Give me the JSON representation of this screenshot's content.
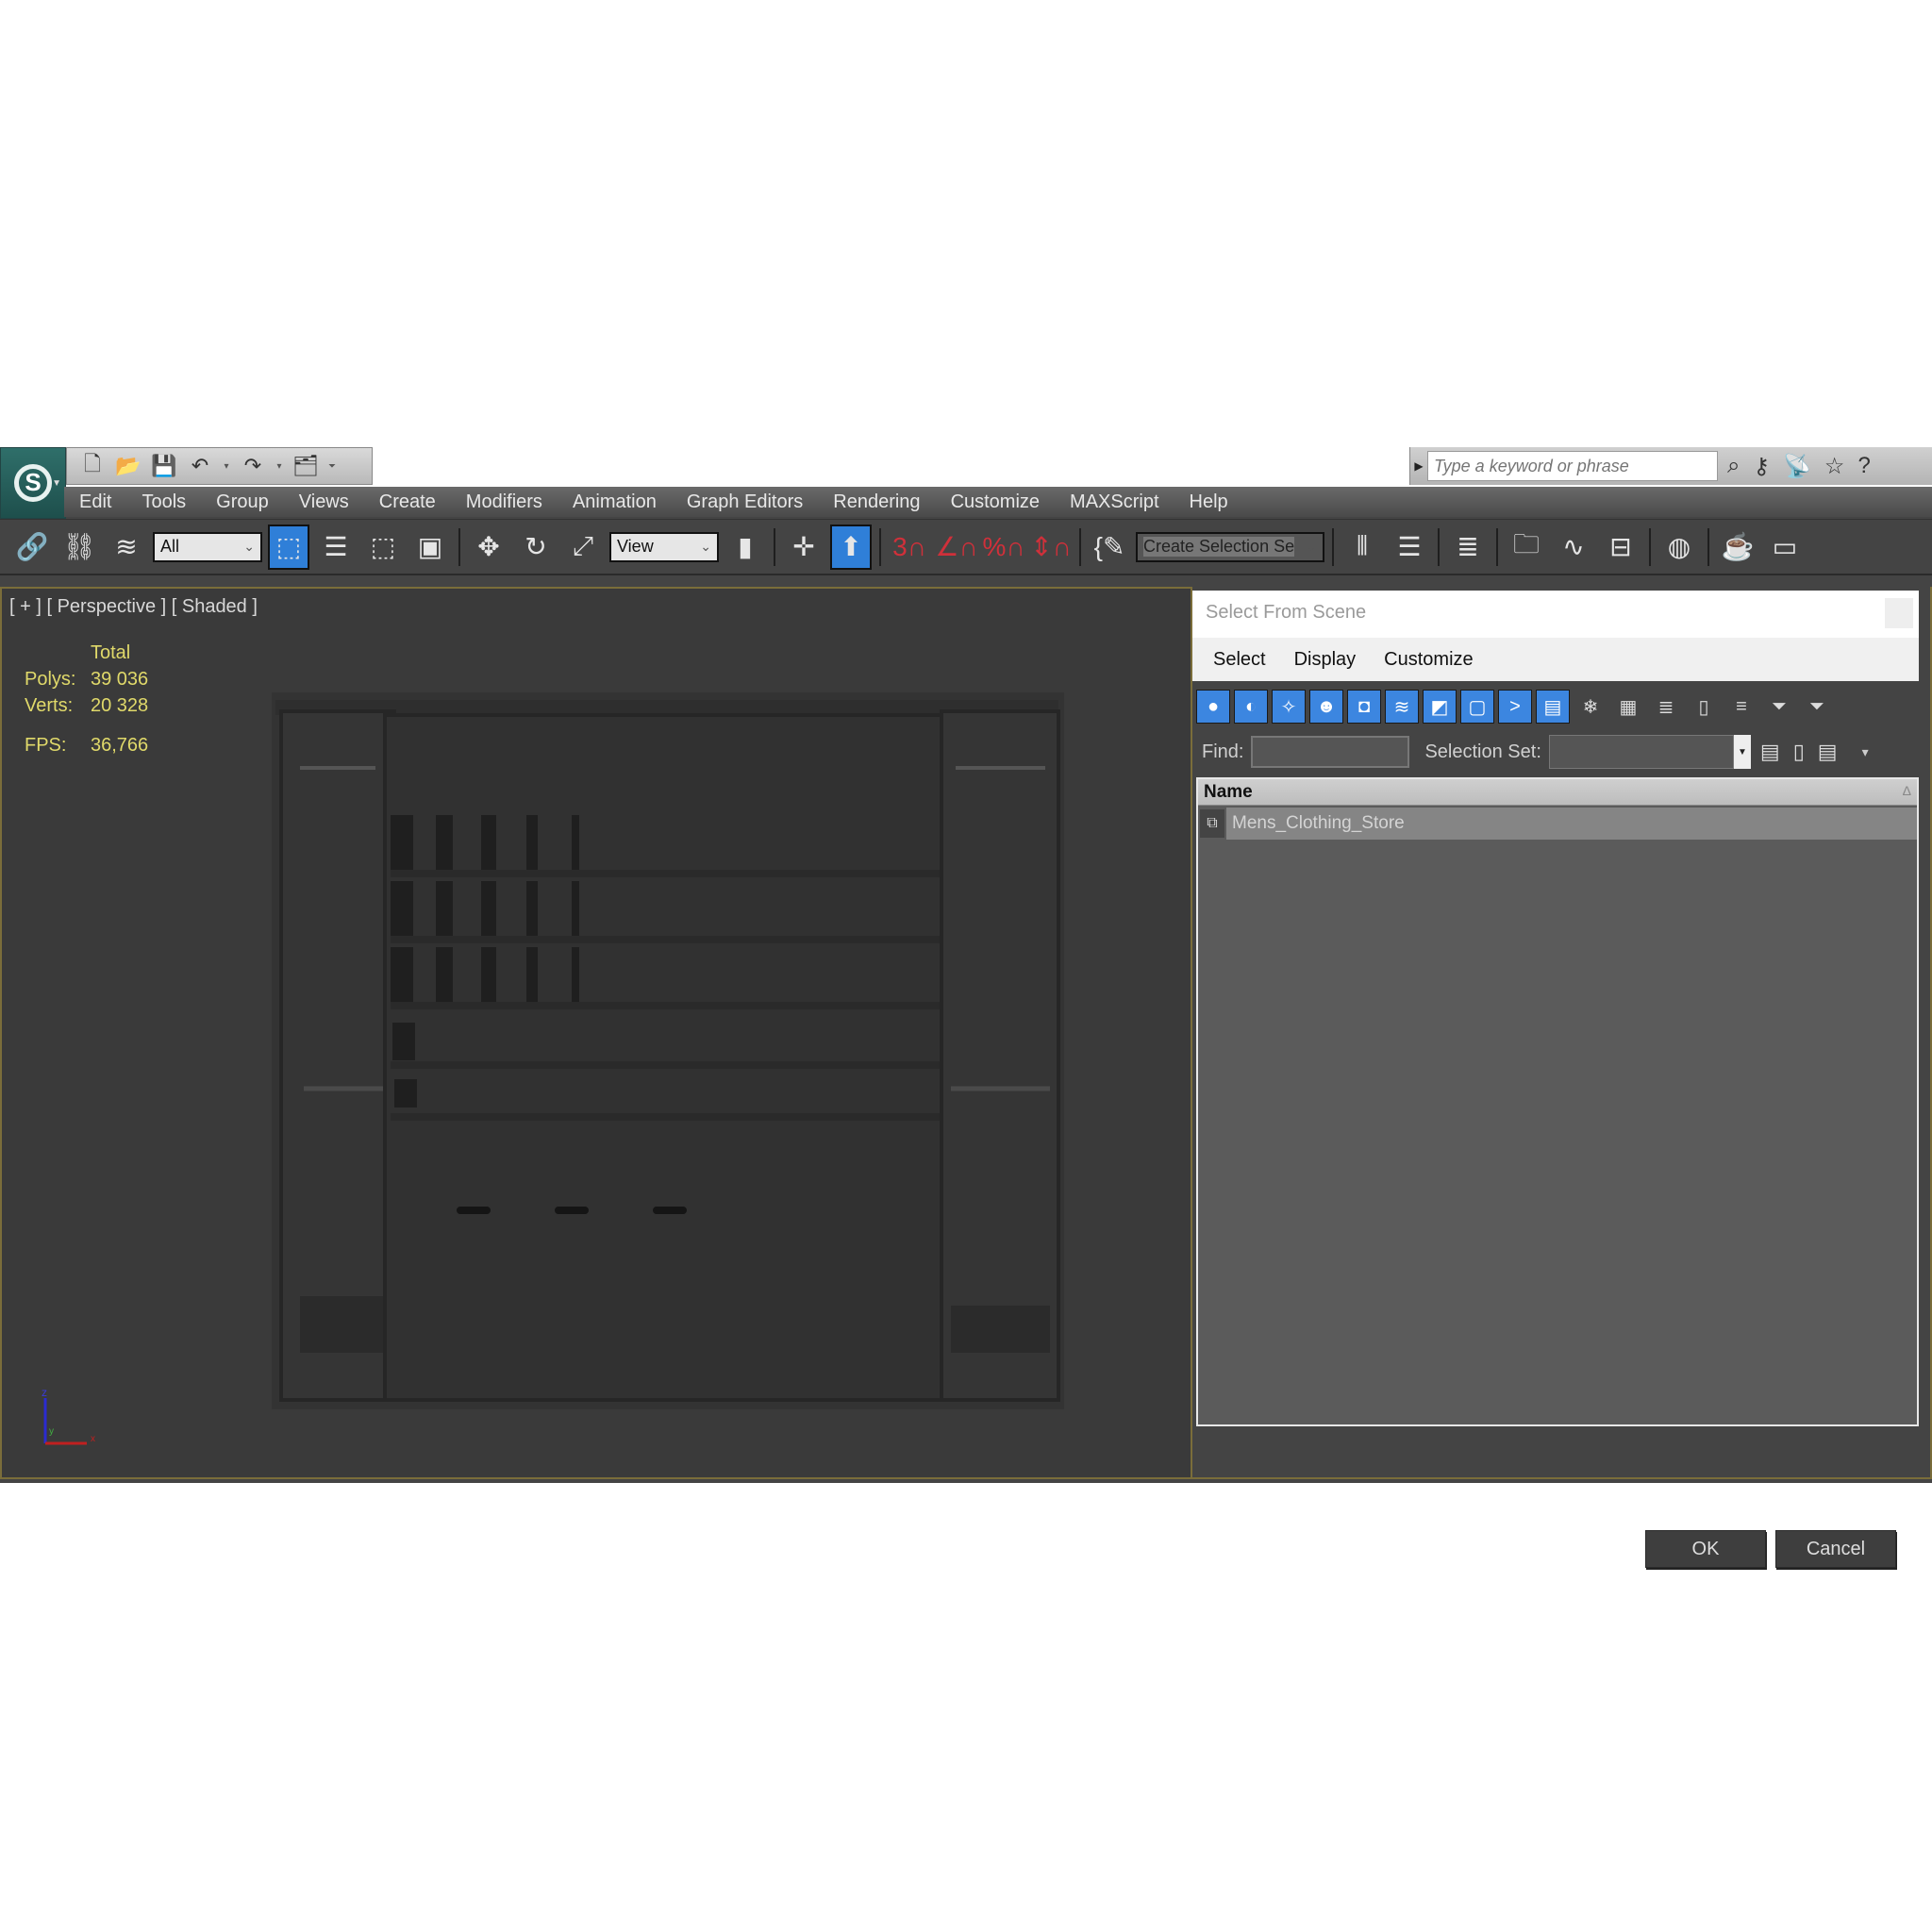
{
  "app": {
    "logo_icon": "3ds-max-logo-icon",
    "quick_access": [
      "new-file-icon",
      "open-file-icon",
      "save-icon",
      "undo-icon",
      "redo-icon",
      "project-folder-icon",
      "customize-toolbar-icon"
    ],
    "search": {
      "placeholder": "Type a keyword or phrase",
      "icons": [
        "binoculars-icon",
        "key-icon",
        "satellite-icon",
        "star-icon",
        "help-icon"
      ]
    }
  },
  "menubar": {
    "items": [
      "Edit",
      "Tools",
      "Group",
      "Views",
      "Create",
      "Modifiers",
      "Animation",
      "Graph Editors",
      "Rendering",
      "Customize",
      "MAXScript",
      "Help"
    ]
  },
  "toolbar": {
    "selection_filter": "All",
    "reference_coord": "View",
    "named_selection_set": "Create Selection Se"
  },
  "viewport": {
    "label": "[ + ] [ Perspective ] [ Shaded ]",
    "stats": {
      "header": "Total",
      "polys_label": "Polys:",
      "polys_value": "39 036",
      "verts_label": "Verts:",
      "verts_value": "20 328",
      "fps_label": "FPS:",
      "fps_value": "36,766"
    },
    "axis": {
      "z": "z",
      "y": "y",
      "x": "x"
    }
  },
  "dialog": {
    "title": "Select From Scene",
    "menu": [
      "Select",
      "Display",
      "Customize"
    ],
    "find_label": "Find:",
    "find_value": "",
    "selection_set_label": "Selection Set:",
    "selection_set_value": "",
    "column_header": "Name",
    "items": [
      {
        "name": "Mens_Clothing_Store",
        "icon": "group-icon",
        "selected": true
      }
    ],
    "ok_label": "OK",
    "cancel_label": "Cancel"
  }
}
